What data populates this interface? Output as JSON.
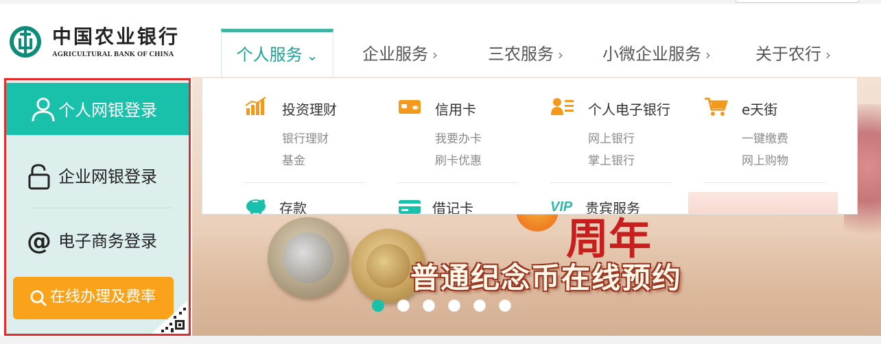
{
  "brand": {
    "name_cn": "中国农业银行",
    "name_en": "AGRICULTURAL BANK OF CHINA",
    "logo_icon": "abc-emblem-icon",
    "accent": "#19c1aa"
  },
  "nav": {
    "items": [
      {
        "label": "个人服务",
        "chevron": "chevron-down-icon",
        "active": true
      },
      {
        "label": "企业服务",
        "chevron": "chevron-right-icon",
        "active": false
      },
      {
        "label": "三农服务",
        "chevron": "chevron-right-icon",
        "active": false
      },
      {
        "label": "小微企业服务",
        "chevron": "chevron-right-icon",
        "active": false
      },
      {
        "label": "关于农行",
        "chevron": "chevron-right-icon",
        "active": false
      }
    ],
    "chev_down": "⌄",
    "chev_right": "›"
  },
  "dropdown": {
    "categories": [
      {
        "title": "投资理财",
        "icon": "bar-chart-icon",
        "links": [
          "银行理财",
          "基金"
        ]
      },
      {
        "title": "信用卡",
        "icon": "credit-card-icon",
        "links": [
          "我要办卡",
          "刷卡优惠"
        ]
      },
      {
        "title": "个人电子银行",
        "icon": "id-card-icon",
        "links": [
          "网上银行",
          "掌上银行"
        ]
      },
      {
        "title": "e天街",
        "icon": "shopping-cart-icon",
        "links": [
          "一键缴费",
          "网上购物"
        ]
      }
    ],
    "second_row": [
      {
        "title": "存款",
        "icon": "piggy-bank-icon"
      },
      {
        "title": "借记卡",
        "icon": "debit-card-icon"
      },
      {
        "title": "贵宾服务",
        "icon": "vip-icon"
      }
    ]
  },
  "login": {
    "personal": {
      "label": "个人网银登录",
      "icon": "user-icon"
    },
    "corporate": {
      "label": "企业网银登录",
      "icon": "lock-icon"
    },
    "ecommerce": {
      "label": "电子商务登录",
      "icon": "at-icon"
    },
    "online_btn": {
      "label": "在线办理及费率",
      "icon": "search-icon"
    },
    "qr_icon": "qr-code-icon"
  },
  "banner": {
    "headline": "普通纪念币在线预约",
    "partial_title": "周年",
    "slides_total": 6,
    "active_slide": 1
  }
}
